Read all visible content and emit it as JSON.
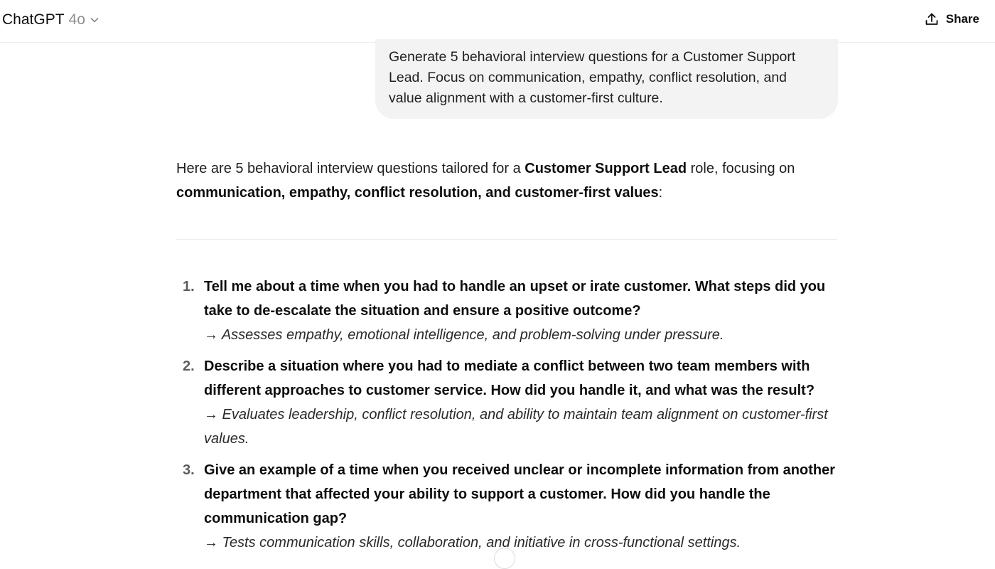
{
  "header": {
    "model_name": "ChatGPT",
    "model_version": "4o",
    "share_label": "Share"
  },
  "conversation": {
    "user_message": "Generate 5 behavioral interview questions for a Customer Support Lead. Focus on communication, empathy, conflict resolution, and value alignment with a customer-first culture.",
    "intro": {
      "part1": "Here are 5 behavioral interview questions tailored for a ",
      "bold1": "Customer Support Lead",
      "part2": " role, focusing on ",
      "bold2": "communication, empathy, conflict resolution, and customer-first values",
      "part3": ":"
    },
    "questions": [
      {
        "number": "1.",
        "question": "Tell me about a time when you had to handle an upset or irate customer. What steps did you take to de-escalate the situation and ensure a positive outcome?",
        "note": "→ Assesses empathy, emotional intelligence, and problem-solving under pressure."
      },
      {
        "number": "2.",
        "question": "Describe a situation where you had to mediate a conflict between two team members with different approaches to customer service. How did you handle it, and what was the result?",
        "note": "→ Evaluates leadership, conflict resolution, and ability to maintain team alignment on customer-first values."
      },
      {
        "number": "3.",
        "question": "Give an example of a time when you received unclear or incomplete information from another department that affected your ability to support a customer. How did you handle the communication gap?",
        "note": "→ Tests communication skills, collaboration, and initiative in cross-functional settings."
      }
    ]
  },
  "icons": {
    "model_dropdown": "chevron-down-icon",
    "share": "share-upload-icon"
  },
  "colors": {
    "text": "#0d0d0d",
    "muted": "#8f8f8f",
    "bubble_bg": "#f3f3f3",
    "divider": "#ececec"
  }
}
